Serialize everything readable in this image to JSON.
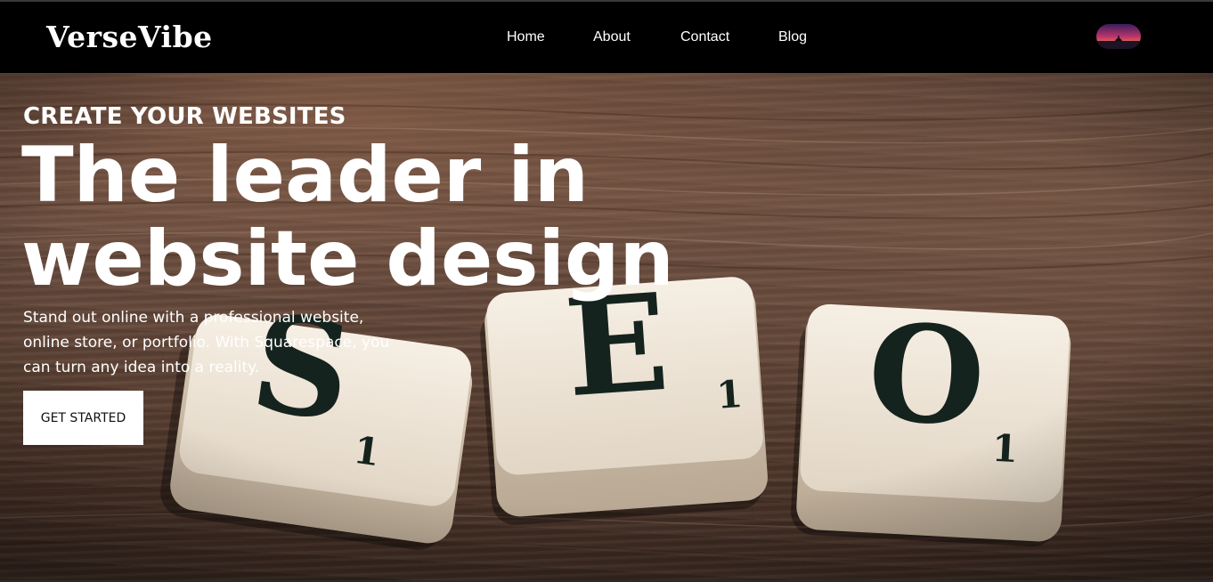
{
  "brand": {
    "name": "VerseVibe"
  },
  "nav": {
    "items": [
      {
        "label": "Home"
      },
      {
        "label": "About"
      },
      {
        "label": "Contact"
      },
      {
        "label": "Blog"
      }
    ]
  },
  "hero": {
    "eyebrow": "CREATE YOUR WEBSITES",
    "headline": "The leader in website design",
    "subtext": "Stand out online with a professional website, online store, or portfolio. With Squarespace, you can turn any idea into a reality.",
    "cta_label": "GET STARTED",
    "tiles": [
      {
        "letter": "S",
        "score": "1"
      },
      {
        "letter": "E",
        "score": "1"
      },
      {
        "letter": "O",
        "score": "1"
      }
    ]
  },
  "colors": {
    "navbar_bg": "#000000",
    "text": "#ffffff",
    "cta_bg": "#ffffff",
    "wood": "#5e4336",
    "tile": "#ece3d6"
  },
  "icons": {
    "avatar": "profile-avatar-sunset-image"
  }
}
